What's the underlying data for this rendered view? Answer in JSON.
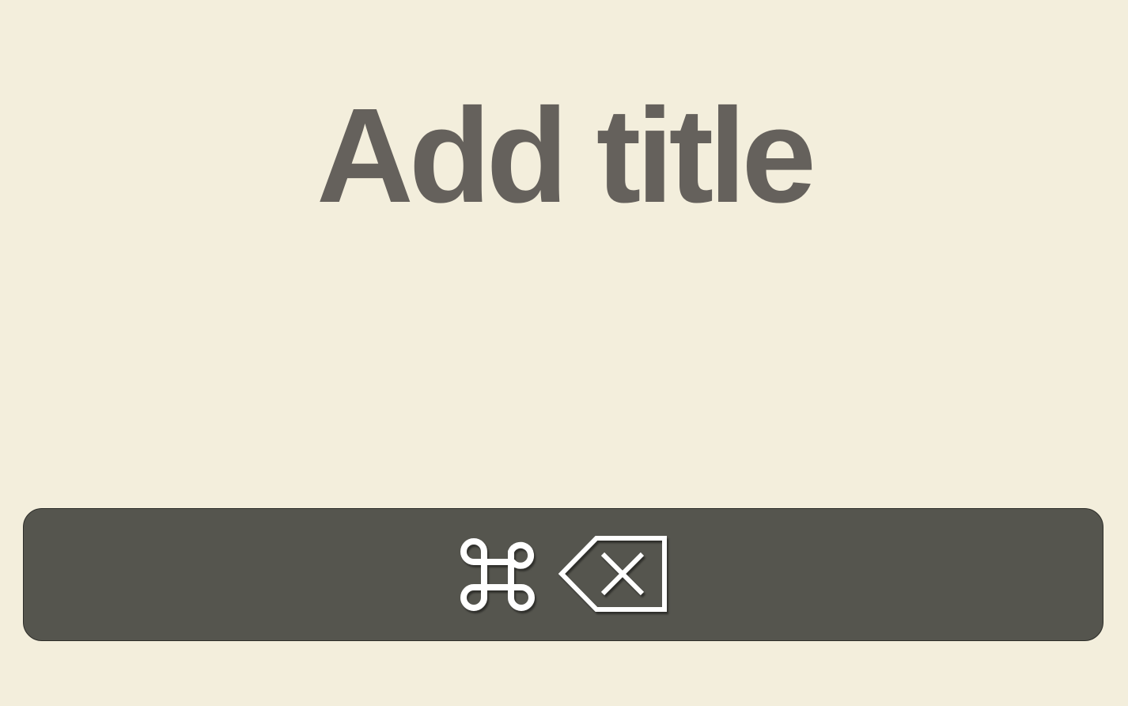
{
  "title": {
    "text": "Add title"
  },
  "shortcut_bar": {
    "keys": [
      "command-icon",
      "delete-icon"
    ]
  },
  "colors": {
    "background": "#f3eedc",
    "title": "#65615c",
    "bar": "#55554e",
    "key_glyph": "#ffffff"
  }
}
